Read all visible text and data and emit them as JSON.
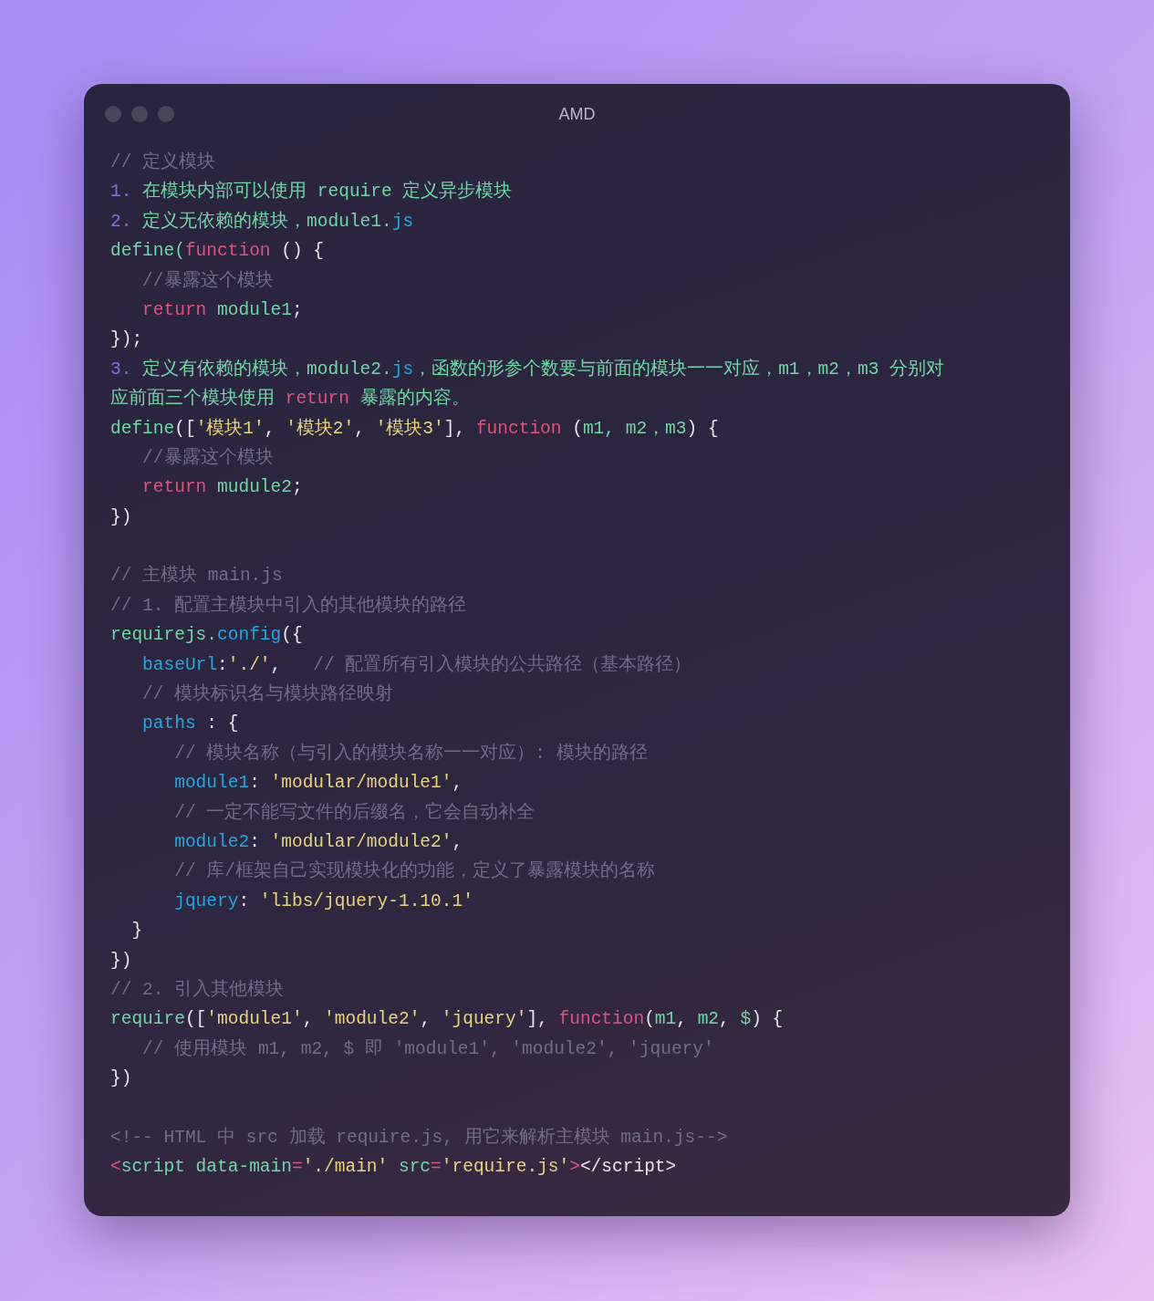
{
  "window": {
    "title": "AMD"
  },
  "blocks": [
    {
      "lines": [
        {
          "tokens": [
            {
              "text": "// 定义模块",
              "color": "#726d86"
            }
          ]
        },
        {
          "tokens": [
            {
              "text": "1.",
              "color": "#7d72e0"
            },
            {
              "text": " 在模块内部可以使用 require 定义异步模块",
              "color": "#6fd6a8"
            }
          ]
        },
        {
          "tokens": [
            {
              "text": "2.",
              "color": "#7d72e0"
            },
            {
              "text": " 定义无依赖的模块，module1.",
              "color": "#6fd6a8"
            },
            {
              "text": "js",
              "color": "#1fa8e6"
            }
          ]
        },
        {
          "tokens": [
            {
              "text": "define(",
              "color": "#6fd6a8"
            },
            {
              "text": "function",
              "color": "#e0527f"
            },
            {
              "text": " () {",
              "color": "#e8e6ee"
            }
          ]
        },
        {
          "tokens": [
            {
              "text": "   //暴露这个模块",
              "color": "#726d86"
            }
          ]
        },
        {
          "tokens": [
            {
              "text": "   return",
              "color": "#e0527f"
            },
            {
              "text": " module1",
              "color": "#6fd6a8"
            },
            {
              "text": ";",
              "color": "#e8e6ee"
            }
          ]
        },
        {
          "tokens": [
            {
              "text": "});",
              "color": "#e8e6ee"
            }
          ]
        },
        {
          "tokens": [
            {
              "text": "3.",
              "color": "#7d72e0"
            },
            {
              "text": " 定义有依赖的模块，module2.",
              "color": "#6fd6a8"
            },
            {
              "text": "js",
              "color": "#1fa8e6"
            },
            {
              "text": "，函数的形参个数要与前面的模块一一对应，m1，m2，m3 分别对",
              "color": "#6fd6a8"
            }
          ]
        },
        {
          "tokens": [
            {
              "text": "应前面三个模块使用 ",
              "color": "#6fd6a8"
            },
            {
              "text": "return",
              "color": "#e0527f"
            },
            {
              "text": " 暴露的内容。",
              "color": "#6fd6a8"
            }
          ]
        },
        {
          "tokens": [
            {
              "text": "define",
              "color": "#6fd6a8"
            },
            {
              "text": "([",
              "color": "#e8e6ee"
            },
            {
              "text": "'模块1'",
              "color": "#e6d47c"
            },
            {
              "text": ", ",
              "color": "#e8e6ee"
            },
            {
              "text": "'模块2'",
              "color": "#e6d47c"
            },
            {
              "text": ", ",
              "color": "#e8e6ee"
            },
            {
              "text": "'模块3'",
              "color": "#e6d47c"
            },
            {
              "text": "], ",
              "color": "#e8e6ee"
            },
            {
              "text": "function",
              "color": "#e0527f"
            },
            {
              "text": " (",
              "color": "#e8e6ee"
            },
            {
              "text": "m1, m2，m3",
              "color": "#6fd6a8"
            },
            {
              "text": ") {",
              "color": "#e8e6ee"
            }
          ]
        },
        {
          "tokens": [
            {
              "text": "   //暴露这个模块",
              "color": "#726d86"
            }
          ]
        },
        {
          "tokens": [
            {
              "text": "   return",
              "color": "#e0527f"
            },
            {
              "text": " mudule2",
              "color": "#6fd6a8"
            },
            {
              "text": ";",
              "color": "#e8e6ee"
            }
          ]
        },
        {
          "tokens": [
            {
              "text": "})",
              "color": "#e8e6ee"
            }
          ]
        }
      ]
    },
    {
      "lines": [
        {
          "tokens": [
            {
              "text": "// 主模块 main.js",
              "color": "#726d86"
            }
          ]
        },
        {
          "tokens": [
            {
              "text": "// 1. 配置主模块中引入的其他模块的路径",
              "color": "#726d86"
            }
          ]
        },
        {
          "tokens": [
            {
              "text": "requirejs.",
              "color": "#6fd6a8"
            },
            {
              "text": "config",
              "color": "#1fa8e6"
            },
            {
              "text": "({",
              "color": "#e8e6ee"
            }
          ]
        },
        {
          "tokens": [
            {
              "text": "   baseUrl",
              "color": "#1fa8e6"
            },
            {
              "text": ":",
              "color": "#e8e6ee"
            },
            {
              "text": "'./'",
              "color": "#e6d47c"
            },
            {
              "text": ",",
              "color": "#e8e6ee"
            },
            {
              "text": "   // 配置所有引入模块的公共路径（基本路径）",
              "color": "#726d86"
            }
          ]
        },
        {
          "tokens": [
            {
              "text": "   // 模块标识名与模块路径映射",
              "color": "#726d86"
            }
          ]
        },
        {
          "tokens": [
            {
              "text": "   paths",
              "color": "#1fa8e6"
            },
            {
              "text": " : {",
              "color": "#e8e6ee"
            }
          ]
        },
        {
          "tokens": [
            {
              "text": "      // 模块名称（与引入的模块名称一一对应）: 模块的路径",
              "color": "#726d86"
            }
          ]
        },
        {
          "tokens": [
            {
              "text": "      module1",
              "color": "#1fa8e6"
            },
            {
              "text": ": ",
              "color": "#e8e6ee"
            },
            {
              "text": "'modular/module1'",
              "color": "#e6d47c"
            },
            {
              "text": ",",
              "color": "#e8e6ee"
            }
          ]
        },
        {
          "tokens": [
            {
              "text": "      // 一定不能写文件的后缀名，它会自动补全",
              "color": "#726d86"
            }
          ]
        },
        {
          "tokens": [
            {
              "text": "      module2",
              "color": "#1fa8e6"
            },
            {
              "text": ": ",
              "color": "#e8e6ee"
            },
            {
              "text": "'modular/module2'",
              "color": "#e6d47c"
            },
            {
              "text": ",",
              "color": "#e8e6ee"
            }
          ]
        },
        {
          "tokens": [
            {
              "text": "      // 库/框架自己实现模块化的功能，定义了暴露模块的名称",
              "color": "#726d86"
            }
          ]
        },
        {
          "tokens": [
            {
              "text": "      jquery",
              "color": "#1fa8e6"
            },
            {
              "text": ": ",
              "color": "#e8e6ee"
            },
            {
              "text": "'libs/jquery-1.10.1'",
              "color": "#e6d47c"
            }
          ]
        },
        {
          "tokens": [
            {
              "text": "  }",
              "color": "#e8e6ee"
            }
          ]
        },
        {
          "tokens": [
            {
              "text": "})",
              "color": "#e8e6ee"
            }
          ]
        },
        {
          "tokens": [
            {
              "text": "// 2. 引入其他模块",
              "color": "#726d86"
            }
          ]
        },
        {
          "tokens": [
            {
              "text": "require",
              "color": "#6fd6a8"
            },
            {
              "text": "([",
              "color": "#e8e6ee"
            },
            {
              "text": "'module1'",
              "color": "#e6d47c"
            },
            {
              "text": ", ",
              "color": "#e8e6ee"
            },
            {
              "text": "'module2'",
              "color": "#e6d47c"
            },
            {
              "text": ", ",
              "color": "#e8e6ee"
            },
            {
              "text": "'jquery'",
              "color": "#e6d47c"
            },
            {
              "text": "], ",
              "color": "#e8e6ee"
            },
            {
              "text": "function",
              "color": "#e0527f"
            },
            {
              "text": "(",
              "color": "#e8e6ee"
            },
            {
              "text": "m1",
              "color": "#6fd6a8"
            },
            {
              "text": ", ",
              "color": "#e8e6ee"
            },
            {
              "text": "m2",
              "color": "#6fd6a8"
            },
            {
              "text": ", ",
              "color": "#e8e6ee"
            },
            {
              "text": "$",
              "color": "#6fd6a8"
            },
            {
              "text": ") {",
              "color": "#e8e6ee"
            }
          ]
        },
        {
          "tokens": [
            {
              "text": "   // 使用模块 m1, m2, $ 即 'module1', 'module2', 'jquery'",
              "color": "#726d86"
            }
          ]
        },
        {
          "tokens": [
            {
              "text": "})",
              "color": "#e8e6ee"
            }
          ]
        }
      ]
    },
    {
      "lines": [
        {
          "tokens": [
            {
              "text": "<!-- HTML 中 src 加载 require.js, 用它来解析主模块 main.js-->",
              "color": "#726d86"
            }
          ]
        },
        {
          "tokens": [
            {
              "text": "<",
              "color": "#e0527f"
            },
            {
              "text": "script data-main",
              "color": "#6fd6a8"
            },
            {
              "text": "=",
              "color": "#e0527f"
            },
            {
              "text": "'./main'",
              "color": "#e6d47c"
            },
            {
              "text": " src",
              "color": "#6fd6a8"
            },
            {
              "text": "=",
              "color": "#e0527f"
            },
            {
              "text": "'require.js'",
              "color": "#e6d47c"
            },
            {
              "text": ">",
              "color": "#e0527f"
            },
            {
              "text": "</script>",
              "color": "#e8e6ee"
            }
          ]
        }
      ]
    }
  ]
}
